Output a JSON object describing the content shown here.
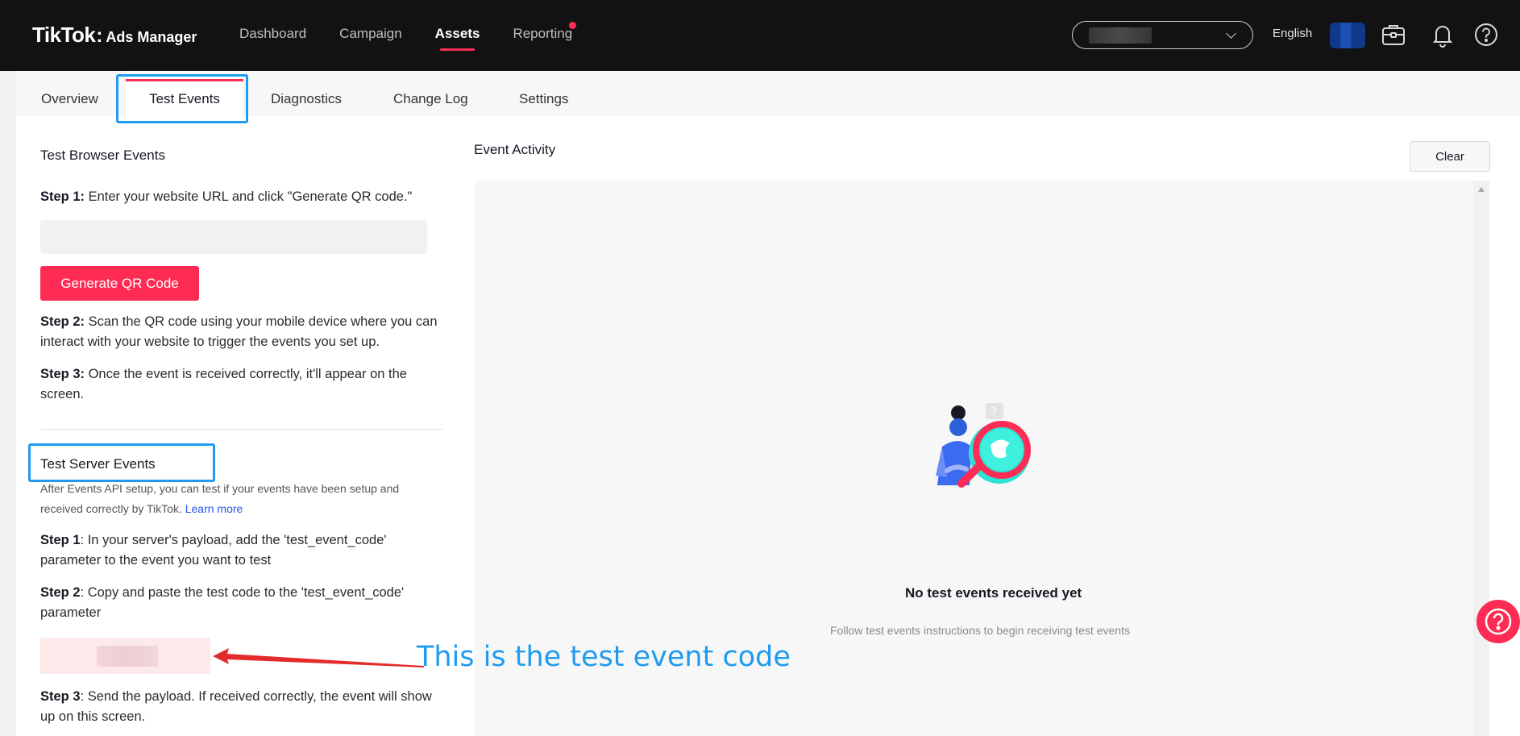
{
  "header": {
    "brand": "TikTok",
    "colon": ":",
    "product": "Ads Manager",
    "nav": [
      {
        "label": "Dashboard"
      },
      {
        "label": "Campaign"
      },
      {
        "label": "Assets",
        "active": true
      },
      {
        "label": "Reporting",
        "has_dot": true
      }
    ],
    "language": "English",
    "accent_color": "#fe2c55"
  },
  "tabs": [
    {
      "label": "Overview"
    },
    {
      "label": "Test Events",
      "active": true
    },
    {
      "label": "Diagnostics"
    },
    {
      "label": "Change Log"
    },
    {
      "label": "Settings"
    }
  ],
  "browser_events": {
    "title": "Test Browser Events",
    "step1_label": "Step 1:",
    "step1_text": " Enter your website URL and click \"Generate QR code.\"",
    "url_value": "",
    "generate_button": "Generate QR Code",
    "step2_label": "Step 2:",
    "step2_text": " Scan the QR code using your mobile device where you can interact with your website to trigger the events you set up.",
    "step3_label": "Step 3:",
    "step3_text": " Once the event is received correctly, it'll appear on the screen."
  },
  "server_events": {
    "title": "Test Server Events",
    "description": "After Events API setup, you can test if your events have been setup and received correctly by TikTok.",
    "learn_more": "Learn more",
    "step1_label": "Step 1",
    "step1_text": ": In your server's payload, add the 'test_event_code' parameter to the event you want to test",
    "step2_label": "Step 2",
    "step2_text": ": Copy and paste the test code to the 'test_event_code' parameter",
    "step3_label": "Step 3",
    "step3_text": ": Send the payload. If received correctly, the event will show up on this screen."
  },
  "event_activity": {
    "title": "Event Activity",
    "clear_button": "Clear",
    "empty_title": "No test events received yet",
    "empty_desc": "Follow test events instructions to begin receiving test events"
  },
  "annotation": {
    "text": "This is the test event code",
    "color": "#1f9bf0"
  }
}
